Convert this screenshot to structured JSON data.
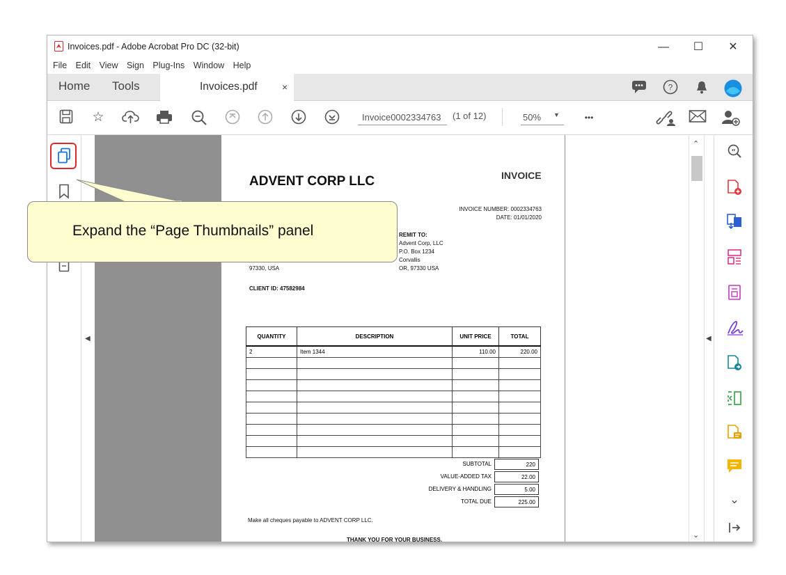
{
  "window": {
    "title": "Invoices.pdf - Adobe Acrobat Pro DC (32-bit)"
  },
  "menu": [
    "File",
    "Edit",
    "View",
    "Sign",
    "Plug-Ins",
    "Window",
    "Help"
  ],
  "tabs": {
    "home": "Home",
    "tools": "Tools",
    "document": "Invoices.pdf",
    "close": "×"
  },
  "toolbar": {
    "page_field": "Invoice0002334763",
    "page_count": "(1 of 12)",
    "zoom": "50%",
    "more": "•••"
  },
  "callout": {
    "text": "Expand the “Page Thumbnails” panel"
  },
  "invoice": {
    "company": "ADVENT CORP LLC",
    "title": "INVOICE",
    "number_line": "INVOICE NUMBER: 0002334763",
    "date_line": "DATE: 01/01/2020",
    "remit_to": "REMIT TO:",
    "remit_1": "Advent Corp, LLC",
    "remit_2": "P.O. Box 1234",
    "remit_3": "Corvallis",
    "remit_4": "OR, 97330 USA",
    "bill_zip": "97330, USA",
    "client_id": "CLIENT ID: 47582984",
    "headers": [
      "QUANTITY",
      "DESCRIPTION",
      "UNIT PRICE",
      "TOTAL"
    ],
    "row1": [
      "2",
      "Item 1344",
      "110.00",
      "220.00"
    ],
    "subtotal_label": "SUBTOTAL",
    "subtotal": "220",
    "vat_label": "VALUE-ADDED TAX",
    "vat": "22.00",
    "delivery_label": "DELIVERY & HANDLING",
    "delivery": "5.00",
    "total_label": "TOTAL DUE",
    "total": "225.00",
    "cheques": "Make all cheques payable to ADVENT CORP LLC.",
    "thanks": "THANK YOU FOR YOUR BUSINESS."
  }
}
